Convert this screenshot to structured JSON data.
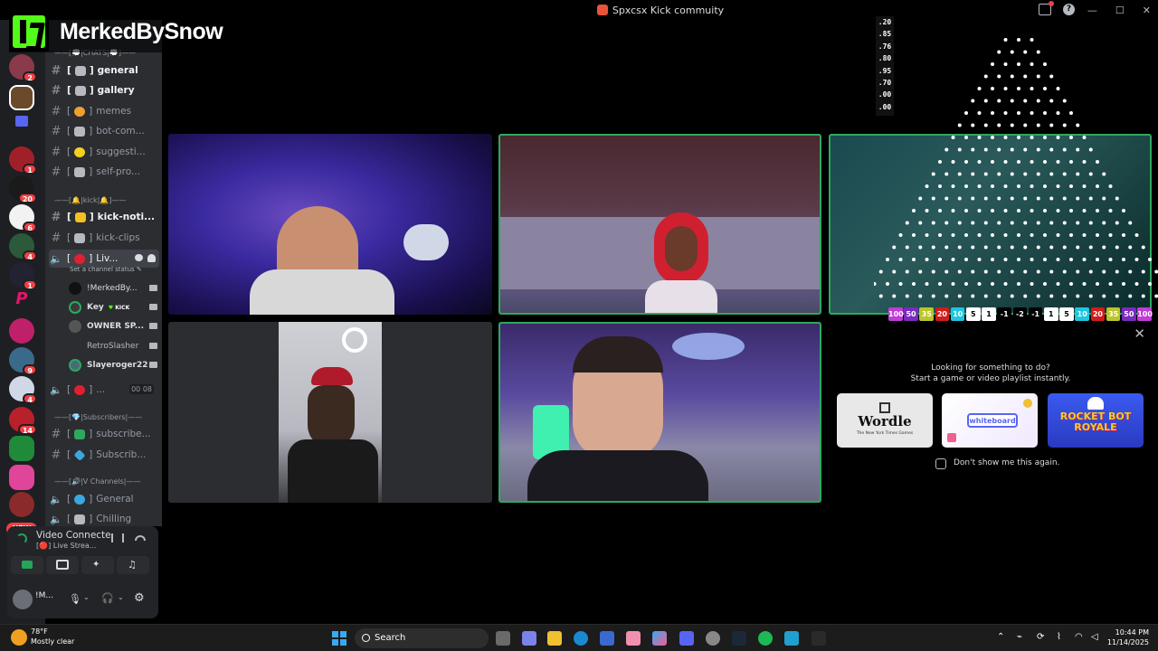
{
  "window": {
    "title": "Spxcsx Kick commuity"
  },
  "overlay": {
    "logo_text": "MerkedBySnow"
  },
  "servers": [
    {
      "badge": "2"
    },
    {
      "badge": ""
    },
    {
      "badge": ""
    },
    {
      "badge": "1"
    },
    {
      "badge": "20"
    },
    {
      "badge": "6"
    },
    {
      "badge": "4"
    },
    {
      "badge": "1"
    },
    {
      "badge": ""
    },
    {
      "badge": ""
    },
    {
      "badge": "9"
    },
    {
      "badge": "4"
    },
    {
      "badge": "14"
    },
    {
      "badge": ""
    },
    {
      "badge": ""
    }
  ],
  "new_badge": "NEW",
  "sidebar": {
    "categories": {
      "chats": "——[💭|CHATS|💭]——",
      "kick": "——[🔔|kick|🔔]——",
      "subs": "——[💎|Subscribers|——",
      "vc": "——[🔊|V Channels|——"
    },
    "channels": {
      "general": "general",
      "gallery": "gallery",
      "memes": "memes",
      "bot": "bot-com...",
      "suggest": "suggesti...",
      "selfpro": "self-pro...",
      "kicknoti": "kick-noti...",
      "kickclips": "kick-clips",
      "live": "Liv...",
      "subscribe": "subscribe...",
      "subscrib": "Subscrib...",
      "vgeneral": "General",
      "chilling": "Chilling"
    },
    "status_note": "Set a channel status ✎",
    "voice_users": [
      "!MerkedBy...",
      "Key",
      "OWNER SP...",
      "RetroSlasher",
      "Slayeroger22"
    ],
    "key_tag": "KICK",
    "second_voice": {
      "label": "...",
      "count_a": "00",
      "count_b": "08"
    }
  },
  "voice_panel": {
    "title": "Video Connecte",
    "subtitle": "[🔴] Live Strea...",
    "user_name": "!M..."
  },
  "activity": {
    "line1": "Looking for something to do?",
    "line2": "Start a game or video playlist instantly.",
    "cards": [
      "Wordle",
      "whiteboard",
      "ROCKET BOT ROYALE"
    ],
    "wordle_sub": "The New York Times Games",
    "dont_show": "Don't show me this again."
  },
  "plinko": {
    "multipliers": [
      ".20",
      ".85",
      ".76",
      ".80",
      ".95",
      ".70",
      ".00",
      ".00"
    ],
    "slots": [
      {
        "v": "100",
        "c": "#c33ad8"
      },
      {
        "v": "50",
        "c": "#7a2bbd"
      },
      {
        "v": "35",
        "c": "#b9c52a"
      },
      {
        "v": "20",
        "c": "#d01c1c"
      },
      {
        "v": "10",
        "c": "#1ec6e0"
      },
      {
        "v": "5",
        "c": "#ffffff"
      },
      {
        "v": "1",
        "c": "#ffffff"
      },
      {
        "v": "-1",
        "c": "#000000"
      },
      {
        "v": "-2",
        "c": "#000000"
      },
      {
        "v": "-1",
        "c": "#000000"
      },
      {
        "v": "1",
        "c": "#ffffff"
      },
      {
        "v": "5",
        "c": "#ffffff"
      },
      {
        "v": "10",
        "c": "#1ec6e0"
      },
      {
        "v": "20",
        "c": "#d01c1c"
      },
      {
        "v": "35",
        "c": "#b9c52a"
      },
      {
        "v": "50",
        "c": "#7a2bbd"
      },
      {
        "v": "100",
        "c": "#c33ad8"
      }
    ]
  },
  "taskbar": {
    "temp": "78°F",
    "weather": "Mostly clear",
    "search": "Search",
    "time": "10:44 PM",
    "date": "11/14/2025"
  }
}
